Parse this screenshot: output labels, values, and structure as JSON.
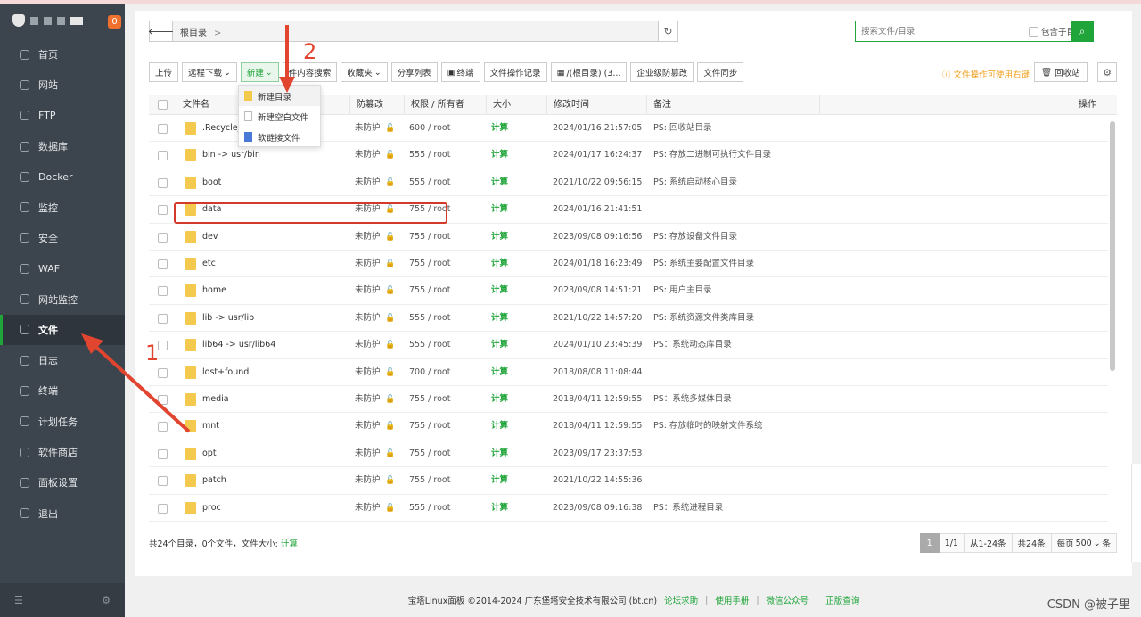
{
  "sidebar": {
    "badge": "0",
    "items": [
      {
        "label": "首页",
        "icon": "home-icon"
      },
      {
        "label": "网站",
        "icon": "globe-icon"
      },
      {
        "label": "FTP",
        "icon": "ftp-icon"
      },
      {
        "label": "数据库",
        "icon": "database-icon"
      },
      {
        "label": "Docker",
        "icon": "docker-icon"
      },
      {
        "label": "监控",
        "icon": "monitor-icon"
      },
      {
        "label": "安全",
        "icon": "shield-icon"
      },
      {
        "label": "WAF",
        "icon": "waf-icon"
      },
      {
        "label": "网站监控",
        "icon": "chart-icon"
      },
      {
        "label": "文件",
        "icon": "folder-icon",
        "active": true
      },
      {
        "label": "日志",
        "icon": "log-icon"
      },
      {
        "label": "终端",
        "icon": "terminal-icon"
      },
      {
        "label": "计划任务",
        "icon": "calendar-icon"
      },
      {
        "label": "软件商店",
        "icon": "store-icon"
      },
      {
        "label": "面板设置",
        "icon": "settings-icon"
      },
      {
        "label": "退出",
        "icon": "logout-icon"
      }
    ]
  },
  "path": {
    "crumb": "根目录",
    "sep": ">"
  },
  "search": {
    "placeholder": "搜索文件/目录",
    "include_sub": "包含子目录"
  },
  "toolbar": {
    "upload": "上传",
    "remote_download": "远程下载",
    "new": "新建",
    "content_search": "件内容搜索",
    "favorites": "收藏夹",
    "share_list": "分享列表",
    "terminal": "终端",
    "op_log": "文件操作记录",
    "disk": "/(根目录) (3...",
    "tamper": "企业级防篡改",
    "sync": "文件同步",
    "tip": "文件操作可使用右键",
    "recycle": "回收站"
  },
  "dropdown": {
    "items": [
      "新建目录",
      "新建空白文件",
      "软链接文件"
    ]
  },
  "table": {
    "headers": {
      "name": "文件名",
      "protect": "防篡改",
      "perm": "权限 / 所有者",
      "size": "大小",
      "mtime": "修改时间",
      "note": "备注",
      "ops": "操作"
    },
    "rows": [
      {
        "name": ".Recycle_",
        "protect": "未防护",
        "perm": "600 / root",
        "size": "计算",
        "mtime": "2024/01/16 21:57:05",
        "note": "PS: 回收站目录"
      },
      {
        "name": "bin -> usr/bin",
        "protect": "未防护",
        "perm": "555 / root",
        "size": "计算",
        "mtime": "2024/01/17 16:24:37",
        "note": "PS: 存放二进制可执行文件目录"
      },
      {
        "name": "boot",
        "protect": "未防护",
        "perm": "555 / root",
        "size": "计算",
        "mtime": "2021/10/22 09:56:15",
        "note": "PS: 系统启动核心目录"
      },
      {
        "name": "data",
        "protect": "未防护",
        "perm": "755 / root",
        "size": "计算",
        "mtime": "2024/01/16 21:41:51",
        "note": ""
      },
      {
        "name": "dev",
        "protect": "未防护",
        "perm": "755 / root",
        "size": "计算",
        "mtime": "2023/09/08 09:16:56",
        "note": "PS: 存放设备文件目录"
      },
      {
        "name": "etc",
        "protect": "未防护",
        "perm": "755 / root",
        "size": "计算",
        "mtime": "2024/01/18 16:23:49",
        "note": "PS: 系统主要配置文件目录"
      },
      {
        "name": "home",
        "protect": "未防护",
        "perm": "755 / root",
        "size": "计算",
        "mtime": "2023/09/08 14:51:21",
        "note": "PS: 用户主目录"
      },
      {
        "name": "lib -> usr/lib",
        "protect": "未防护",
        "perm": "555 / root",
        "size": "计算",
        "mtime": "2021/10/22 14:57:20",
        "note": "PS: 系统资源文件类库目录"
      },
      {
        "name": "lib64 -> usr/lib64",
        "protect": "未防护",
        "perm": "555 / root",
        "size": "计算",
        "mtime": "2024/01/10 23:45:39",
        "note": "PS：系统动态库目录"
      },
      {
        "name": "lost+found",
        "protect": "未防护",
        "perm": "700 / root",
        "size": "计算",
        "mtime": "2018/08/08 11:08:44",
        "note": ""
      },
      {
        "name": "media",
        "protect": "未防护",
        "perm": "755 / root",
        "size": "计算",
        "mtime": "2018/04/11 12:59:55",
        "note": "PS：系统多媒体目录"
      },
      {
        "name": "mnt",
        "protect": "未防护",
        "perm": "755 / root",
        "size": "计算",
        "mtime": "2018/04/11 12:59:55",
        "note": "PS: 存放临时的映射文件系统"
      },
      {
        "name": "opt",
        "protect": "未防护",
        "perm": "755 / root",
        "size": "计算",
        "mtime": "2023/09/17 23:37:53",
        "note": ""
      },
      {
        "name": "patch",
        "protect": "未防护",
        "perm": "755 / root",
        "size": "计算",
        "mtime": "2021/10/22 14:55:36",
        "note": ""
      },
      {
        "name": "proc",
        "protect": "未防护",
        "perm": "555 / root",
        "size": "计算",
        "mtime": "2023/09/08 09:16:38",
        "note": "PS：系统进程目录"
      }
    ]
  },
  "summary": {
    "text": "共24个目录，0个文件，文件大小:",
    "calc": "计算"
  },
  "pager": {
    "current": "1",
    "pages": "1/1",
    "range": "从1-24条",
    "total": "共24条",
    "per_page_label": "每页",
    "per_page": "500",
    "unit": "条"
  },
  "footer": {
    "copyright": "宝塔Linux面板 ©2014-2024 广东堡塔安全技术有限公司 (bt.cn)",
    "links": [
      "论坛求助",
      "使用手册",
      "微信公众号",
      "正版查询"
    ],
    "sep": "|"
  },
  "watermark": "CSDN @被子里",
  "annotations": {
    "one": "1",
    "two": "2"
  }
}
